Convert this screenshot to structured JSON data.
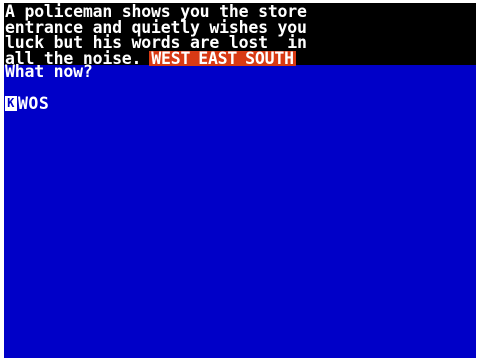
{
  "narrative": {
    "lines": [
      "A policeman shows you the store",
      "entrance and quietly wishes you",
      "luck but his words are lost  in",
      "all the noise."
    ]
  },
  "exits": [
    "WEST",
    "EAST",
    "SOUTH"
  ],
  "prompt": "What now?",
  "input": {
    "cursor": "K",
    "value": "WOS"
  },
  "colors": {
    "background": "#0000c8",
    "narrative_bg": "#000000",
    "exits_bg": "#d83a14",
    "text": "#ffffff"
  }
}
